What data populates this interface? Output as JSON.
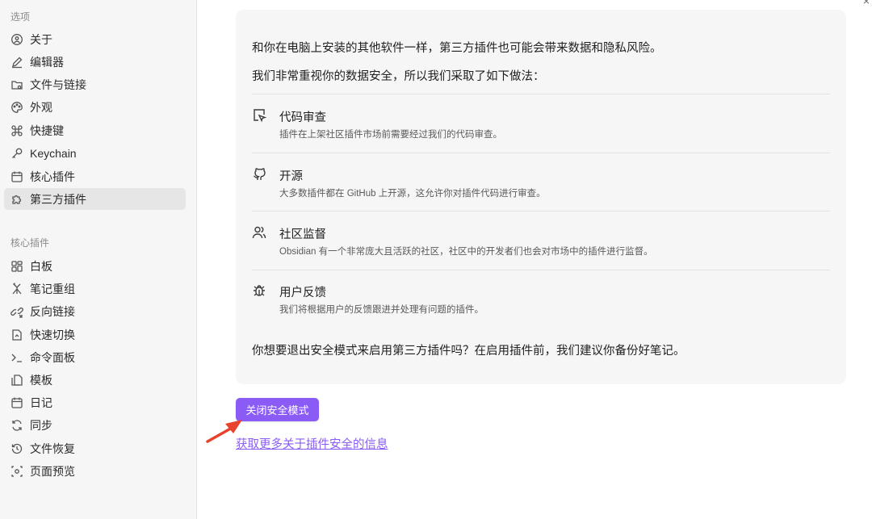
{
  "sidebar": {
    "section_options": "选项",
    "options": [
      {
        "label": "关于",
        "icon": "info-circle-icon"
      },
      {
        "label": "编辑器",
        "icon": "pencil-icon"
      },
      {
        "label": "文件与链接",
        "icon": "folder-link-icon"
      },
      {
        "label": "外观",
        "icon": "palette-icon"
      },
      {
        "label": "快捷键",
        "icon": "command-icon"
      },
      {
        "label": "Keychain",
        "icon": "key-icon"
      },
      {
        "label": "核心插件",
        "icon": "calendar-box-icon"
      },
      {
        "label": "第三方插件",
        "icon": "puzzle-icon",
        "active": true
      }
    ],
    "section_core": "核心插件",
    "core": [
      {
        "label": "白板",
        "icon": "grid-icon"
      },
      {
        "label": "笔记重组",
        "icon": "merge-icon"
      },
      {
        "label": "反向链接",
        "icon": "backlink-icon"
      },
      {
        "label": "快速切换",
        "icon": "file-switch-icon"
      },
      {
        "label": "命令面板",
        "icon": "terminal-icon"
      },
      {
        "label": "模板",
        "icon": "template-icon"
      },
      {
        "label": "日记",
        "icon": "calendar-icon"
      },
      {
        "label": "同步",
        "icon": "sync-icon"
      },
      {
        "label": "文件恢复",
        "icon": "history-icon"
      },
      {
        "label": "页面预览",
        "icon": "eye-icon"
      }
    ]
  },
  "main": {
    "close_label": "×",
    "intro1": "和你在电脑上安装的其他软件一样，第三方插件也可能会带来数据和隐私风险。",
    "intro2": "我们非常重视你的数据安全，所以我们采取了如下做法：",
    "features": [
      {
        "title": "代码审查",
        "desc": "插件在上架社区插件市场前需要经过我们的代码审查。",
        "icon": "code-review-icon"
      },
      {
        "title": "开源",
        "desc": "大多数插件都在 GitHub 上开源，这允许你对插件代码进行审查。",
        "icon": "github-icon"
      },
      {
        "title": "社区监督",
        "desc": "Obsidian 有一个非常庞大且活跃的社区，社区中的开发者们也会对市场中的插件进行监督。",
        "icon": "users-icon"
      },
      {
        "title": "用户反馈",
        "desc": "我们将根据用户的反馈跟进并处理有问题的插件。",
        "icon": "bug-icon"
      }
    ],
    "question": "你想要退出安全模式来启用第三方插件吗？在启用插件前，我们建议你备份好笔记。",
    "button_label": "关闭安全模式",
    "link_label": "获取更多关于插件安全的信息",
    "accent_color": "#8a5cf5",
    "arrow_color": "#e8412c"
  }
}
